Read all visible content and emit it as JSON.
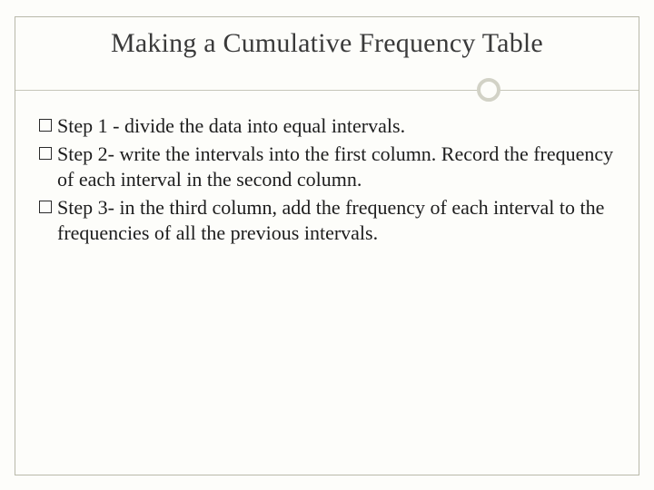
{
  "title": "Making a Cumulative Frequency Table",
  "items": [
    "Step 1 - divide the data into equal intervals.",
    "Step 2- write the intervals into the first column. Record the frequency of each interval in the second column.",
    "Step 3- in the third column, add the frequency of each interval to the frequencies of all the previous intervals."
  ]
}
